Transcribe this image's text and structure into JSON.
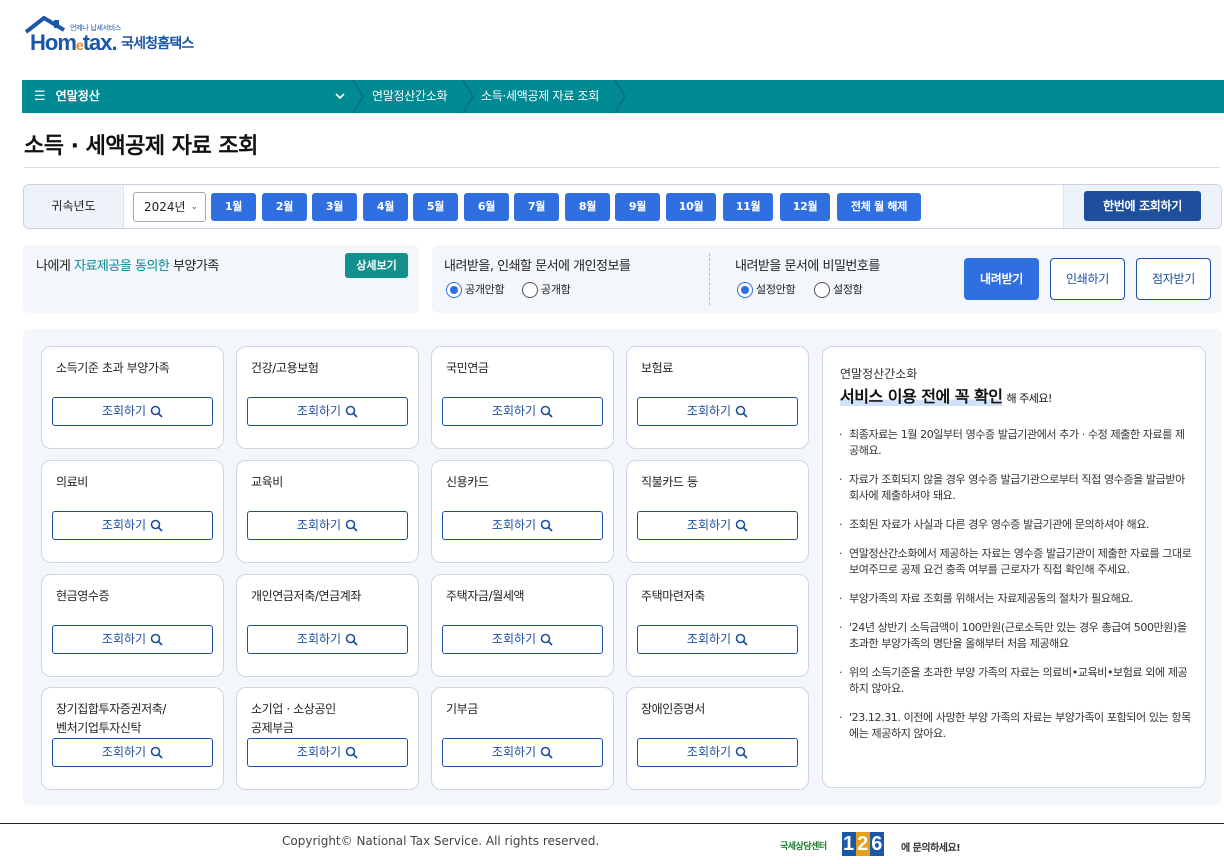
{
  "header": {
    "logo_tagline": "언제나 납세서비스",
    "logo_brand_a": "Hom",
    "logo_brand_b": "e",
    "logo_brand_c": "tax.",
    "logo_korean": "국세청홈택스"
  },
  "nav": {
    "menu_label": "연말정산",
    "breadcrumbs": [
      "연말정산간소화",
      "소득·세액공제 자료 조회"
    ]
  },
  "page_title": "소득 · 세액공제 자료 조회",
  "year_bar": {
    "label": "귀속년도",
    "selected_year": "2024년",
    "months": [
      "1월",
      "2월",
      "3월",
      "4월",
      "5월",
      "6월",
      "7월",
      "8월",
      "9월",
      "10월",
      "11월",
      "12월"
    ],
    "clear_months": "전체 월 해제",
    "query_all": "한번에 조회하기"
  },
  "consent": {
    "text_a": "나에게 ",
    "text_highlight": "자료제공을 동의한",
    "text_b": " 부양가족",
    "detail_button": "상세보기"
  },
  "options": {
    "personal_info_heading": "내려받을, 인쇄할 문서에 개인정보를",
    "personal_info_options": [
      "공개안함",
      "공개함"
    ],
    "personal_info_selected": "공개안함",
    "password_heading": "내려받을 문서에 비밀번호를",
    "password_options": [
      "설정안함",
      "설정함"
    ],
    "password_selected": "설정안함",
    "download": "내려받기",
    "print": "인쇄하기",
    "braille": "점자받기"
  },
  "cards": [
    {
      "title": "소득기준 초과 부양가족",
      "button": "조회하기"
    },
    {
      "title": "건강/고용보험",
      "button": "조회하기"
    },
    {
      "title": "국민연금",
      "button": "조회하기"
    },
    {
      "title": "보험료",
      "button": "조회하기"
    },
    {
      "title": "의료비",
      "button": "조회하기"
    },
    {
      "title": "교육비",
      "button": "조회하기"
    },
    {
      "title": "신용카드",
      "button": "조회하기"
    },
    {
      "title": "직불카드 등",
      "button": "조회하기"
    },
    {
      "title": "현금영수증",
      "button": "조회하기"
    },
    {
      "title": "개인연금저축/연금계좌",
      "button": "조회하기"
    },
    {
      "title": "주택자금/월세액",
      "button": "조회하기"
    },
    {
      "title": "주택마련저축",
      "button": "조회하기"
    },
    {
      "title": "장기집합투자증권저축/\n벤처기업투자신탁",
      "button": "조회하기"
    },
    {
      "title": "소기업 · 소상공인\n공제부금",
      "button": "조회하기"
    },
    {
      "title": "기부금",
      "button": "조회하기"
    },
    {
      "title": "장애인증명서",
      "button": "조회하기"
    }
  ],
  "info": {
    "small": "연말정산간소화",
    "big_highlight": "서비스 이용 전에 꼭 확인",
    "big_suffix": "해 주세요!",
    "notes": [
      "최종자료는 1월 20일부터 영수증 발급기관에서 추가 · 수정 제출한 자료를 제공해요.",
      "자료가 조회되지 않을 경우 영수증 발급기관으로부터 직접 영수증을 발급받아 회사에 제출하셔야 돼요.",
      "조회된 자료가 사실과 다른 경우 영수증 발급기관에 문의하셔야 해요.",
      "연말정산간소화에서 제공하는 자료는 영수증 발급기관이 제출한 자료를 그대로 보여주므로 공제 요건 충족 여부를 근로자가 직접 확인해 주세요.",
      "부양가족의 자료 조회를 위해서는 자료제공동의 절차가 필요해요.",
      "'24년 상반기 소득금액이 100만원(근로소득만 있는 경우 총급여 500만원)을 초과한 부양가족의 명단을 올해부터 처음 제공해요",
      "위의 소득기준을 초과한 부양 가족의 자료는 의료비•교육비•보험료 외에 제공하지 않아요.",
      "'23.12.31. 이전에 사망한 부양 가족의 자료는 부양가족이 포함되어 있는 항목에는 제공하지 않아요."
    ]
  },
  "footer": {
    "copyright": "Copyright© National Tax Service. All rights reserved.",
    "call_center_label": "국세상담센터",
    "call_center_number": [
      "1",
      "2",
      "6"
    ],
    "call_center_suffix": "에 문의하세요!"
  },
  "colors": {
    "nav": "#008a94",
    "month_button": "#2f6fe0",
    "primary_dark": "#1d4f9d",
    "panel_bg": "#f3f6fb"
  }
}
